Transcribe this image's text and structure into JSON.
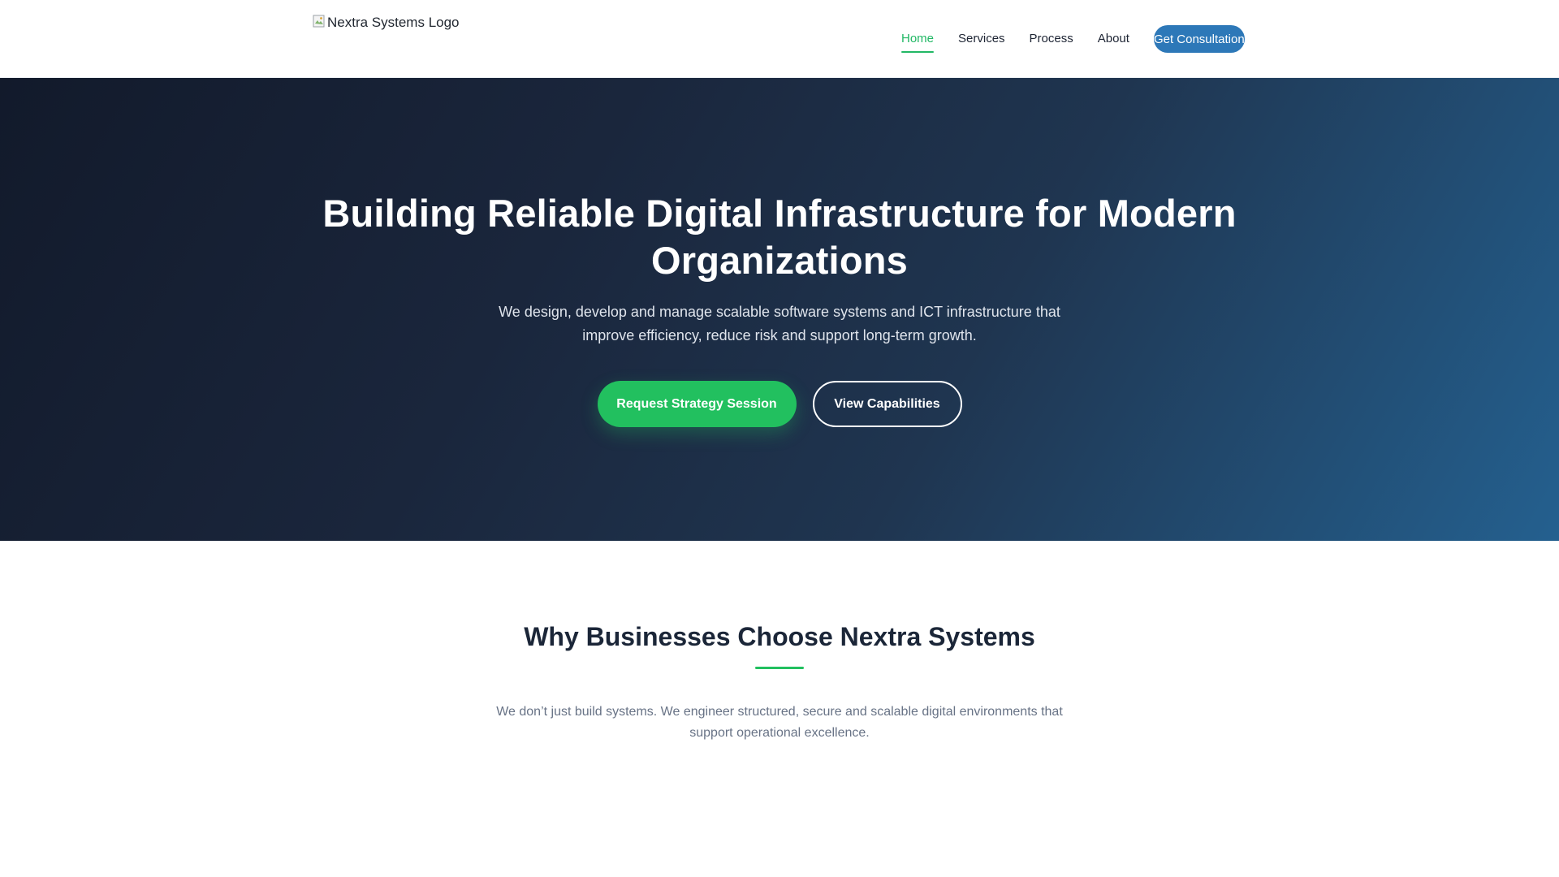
{
  "header": {
    "logo_alt": "Nextra Systems Logo",
    "nav": [
      {
        "label": "Home",
        "active": true
      },
      {
        "label": "Services",
        "active": false
      },
      {
        "label": "Process",
        "active": false
      },
      {
        "label": "About",
        "active": false
      }
    ],
    "cta_label": "Get Consultation"
  },
  "hero": {
    "title": "Building Reliable Digital Infrastructure for Modern Organizations",
    "subtitle": "We design, develop and manage scalable software systems and ICT infrastructure that improve efficiency, reduce risk and support long-term growth.",
    "primary_button": "Request Strategy Session",
    "secondary_button": "View Capabilities"
  },
  "why": {
    "title": "Why Businesses Choose Nextra Systems",
    "text": "We don’t just build systems. We engineer structured, secure and scalable digital environments that support operational excellence."
  },
  "colors": {
    "accent_green": "#22c05f",
    "brand_blue": "#2d78b8",
    "hero_dark": "#121a2b",
    "heading_dark": "#1b2638"
  },
  "icons": {
    "logo": "broken-image-icon"
  }
}
